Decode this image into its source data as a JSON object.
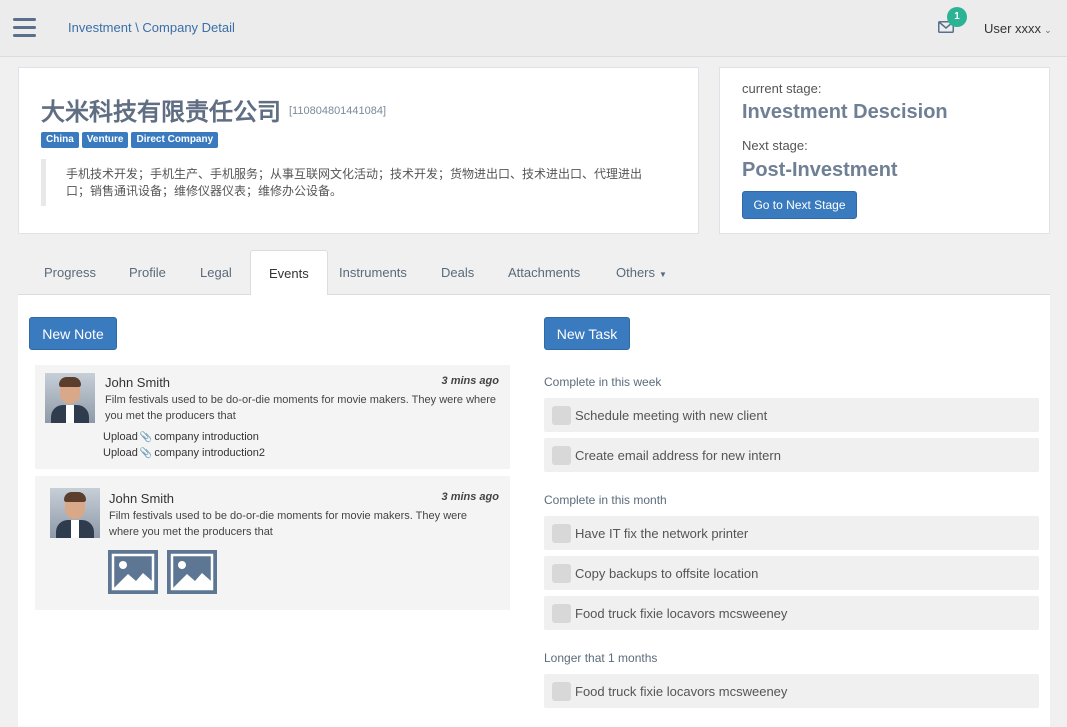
{
  "header": {
    "breadcrumb": "Investment \\ Company Detail",
    "mail_badge": "1",
    "user": "User xxxx"
  },
  "company": {
    "name": "大米科技有限责任公司",
    "code": "[110804801441084]",
    "tags": [
      "China",
      "Venture",
      "Direct Company"
    ],
    "description": "手机技术开发；手机生产、手机服务；从事互联网文化活动；技术开发；货物进出口、技术进出口、代理进出口；销售通讯设备；维修仪器仪表；维修办公设备。"
  },
  "stage": {
    "current_label": "current stage:",
    "current_value": "Investment Descision",
    "next_label": "Next stage:",
    "next_value": "Post-Investment",
    "button": "Go to Next Stage"
  },
  "tabs": [
    {
      "label": "Progress"
    },
    {
      "label": "Profile"
    },
    {
      "label": "Legal"
    },
    {
      "label": "Events",
      "active": true
    },
    {
      "label": "Instruments"
    },
    {
      "label": "Deals"
    },
    {
      "label": "Attachments"
    },
    {
      "label": "Others"
    }
  ],
  "notes_panel": {
    "new_note": "New Note",
    "notes": [
      {
        "author": "John Smith",
        "time": "3 mins ago",
        "text": "Film festivals used to be do-or-die moments for movie makers. They were where you met the producers that",
        "uploads": [
          {
            "prefix": "Upload",
            "file": "company introduction"
          },
          {
            "prefix": "Upload",
            "file": "company introduction2"
          }
        ]
      },
      {
        "author": "John Smith",
        "time": "3 mins ago",
        "text": "Film festivals used to be do-or-die moments for movie makers. They were where you met the producers that"
      }
    ]
  },
  "tasks_panel": {
    "new_task": "New Task",
    "groups": [
      {
        "title": "Complete in this week",
        "items": [
          "Schedule meeting with new client",
          "Create email address for new intern"
        ]
      },
      {
        "title": "Complete in this month",
        "items": [
          "Have IT fix the network printer",
          "Copy backups to offsite location",
          "Food truck fixie locavors mcsweeney"
        ]
      },
      {
        "title": "Longer that 1 months",
        "items": [
          "Food truck fixie locavors mcsweeney"
        ]
      }
    ]
  }
}
